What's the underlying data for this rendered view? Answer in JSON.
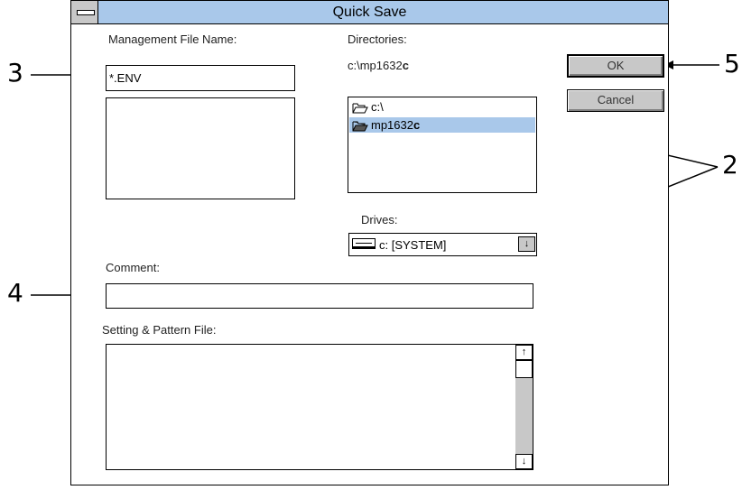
{
  "window": {
    "title": "Quick Save"
  },
  "management_file": {
    "label": "Management File Name:",
    "value": "*.ENV"
  },
  "directories": {
    "label": "Directories:",
    "path_prefix": "c:\\mp1632",
    "path_suffix": "c",
    "items": [
      {
        "label": "c:\\",
        "icon": "open-folder-icon"
      },
      {
        "label_prefix": "mp1632",
        "label_suffix": "c",
        "icon": "open-folder-icon",
        "selected": true
      }
    ]
  },
  "drives": {
    "label": "Drives:",
    "value": "c: [SYSTEM]"
  },
  "buttons": {
    "ok": "OK",
    "cancel": "Cancel"
  },
  "comment": {
    "label": "Comment:",
    "value": ""
  },
  "setting_pattern": {
    "label": "Setting & Pattern File:"
  },
  "callouts": [
    "2",
    "3",
    "4",
    "5"
  ],
  "colors": {
    "titlebar": "#a9c8ea",
    "selection": "#a9c8ea",
    "button_face": "#c8c8c8"
  }
}
